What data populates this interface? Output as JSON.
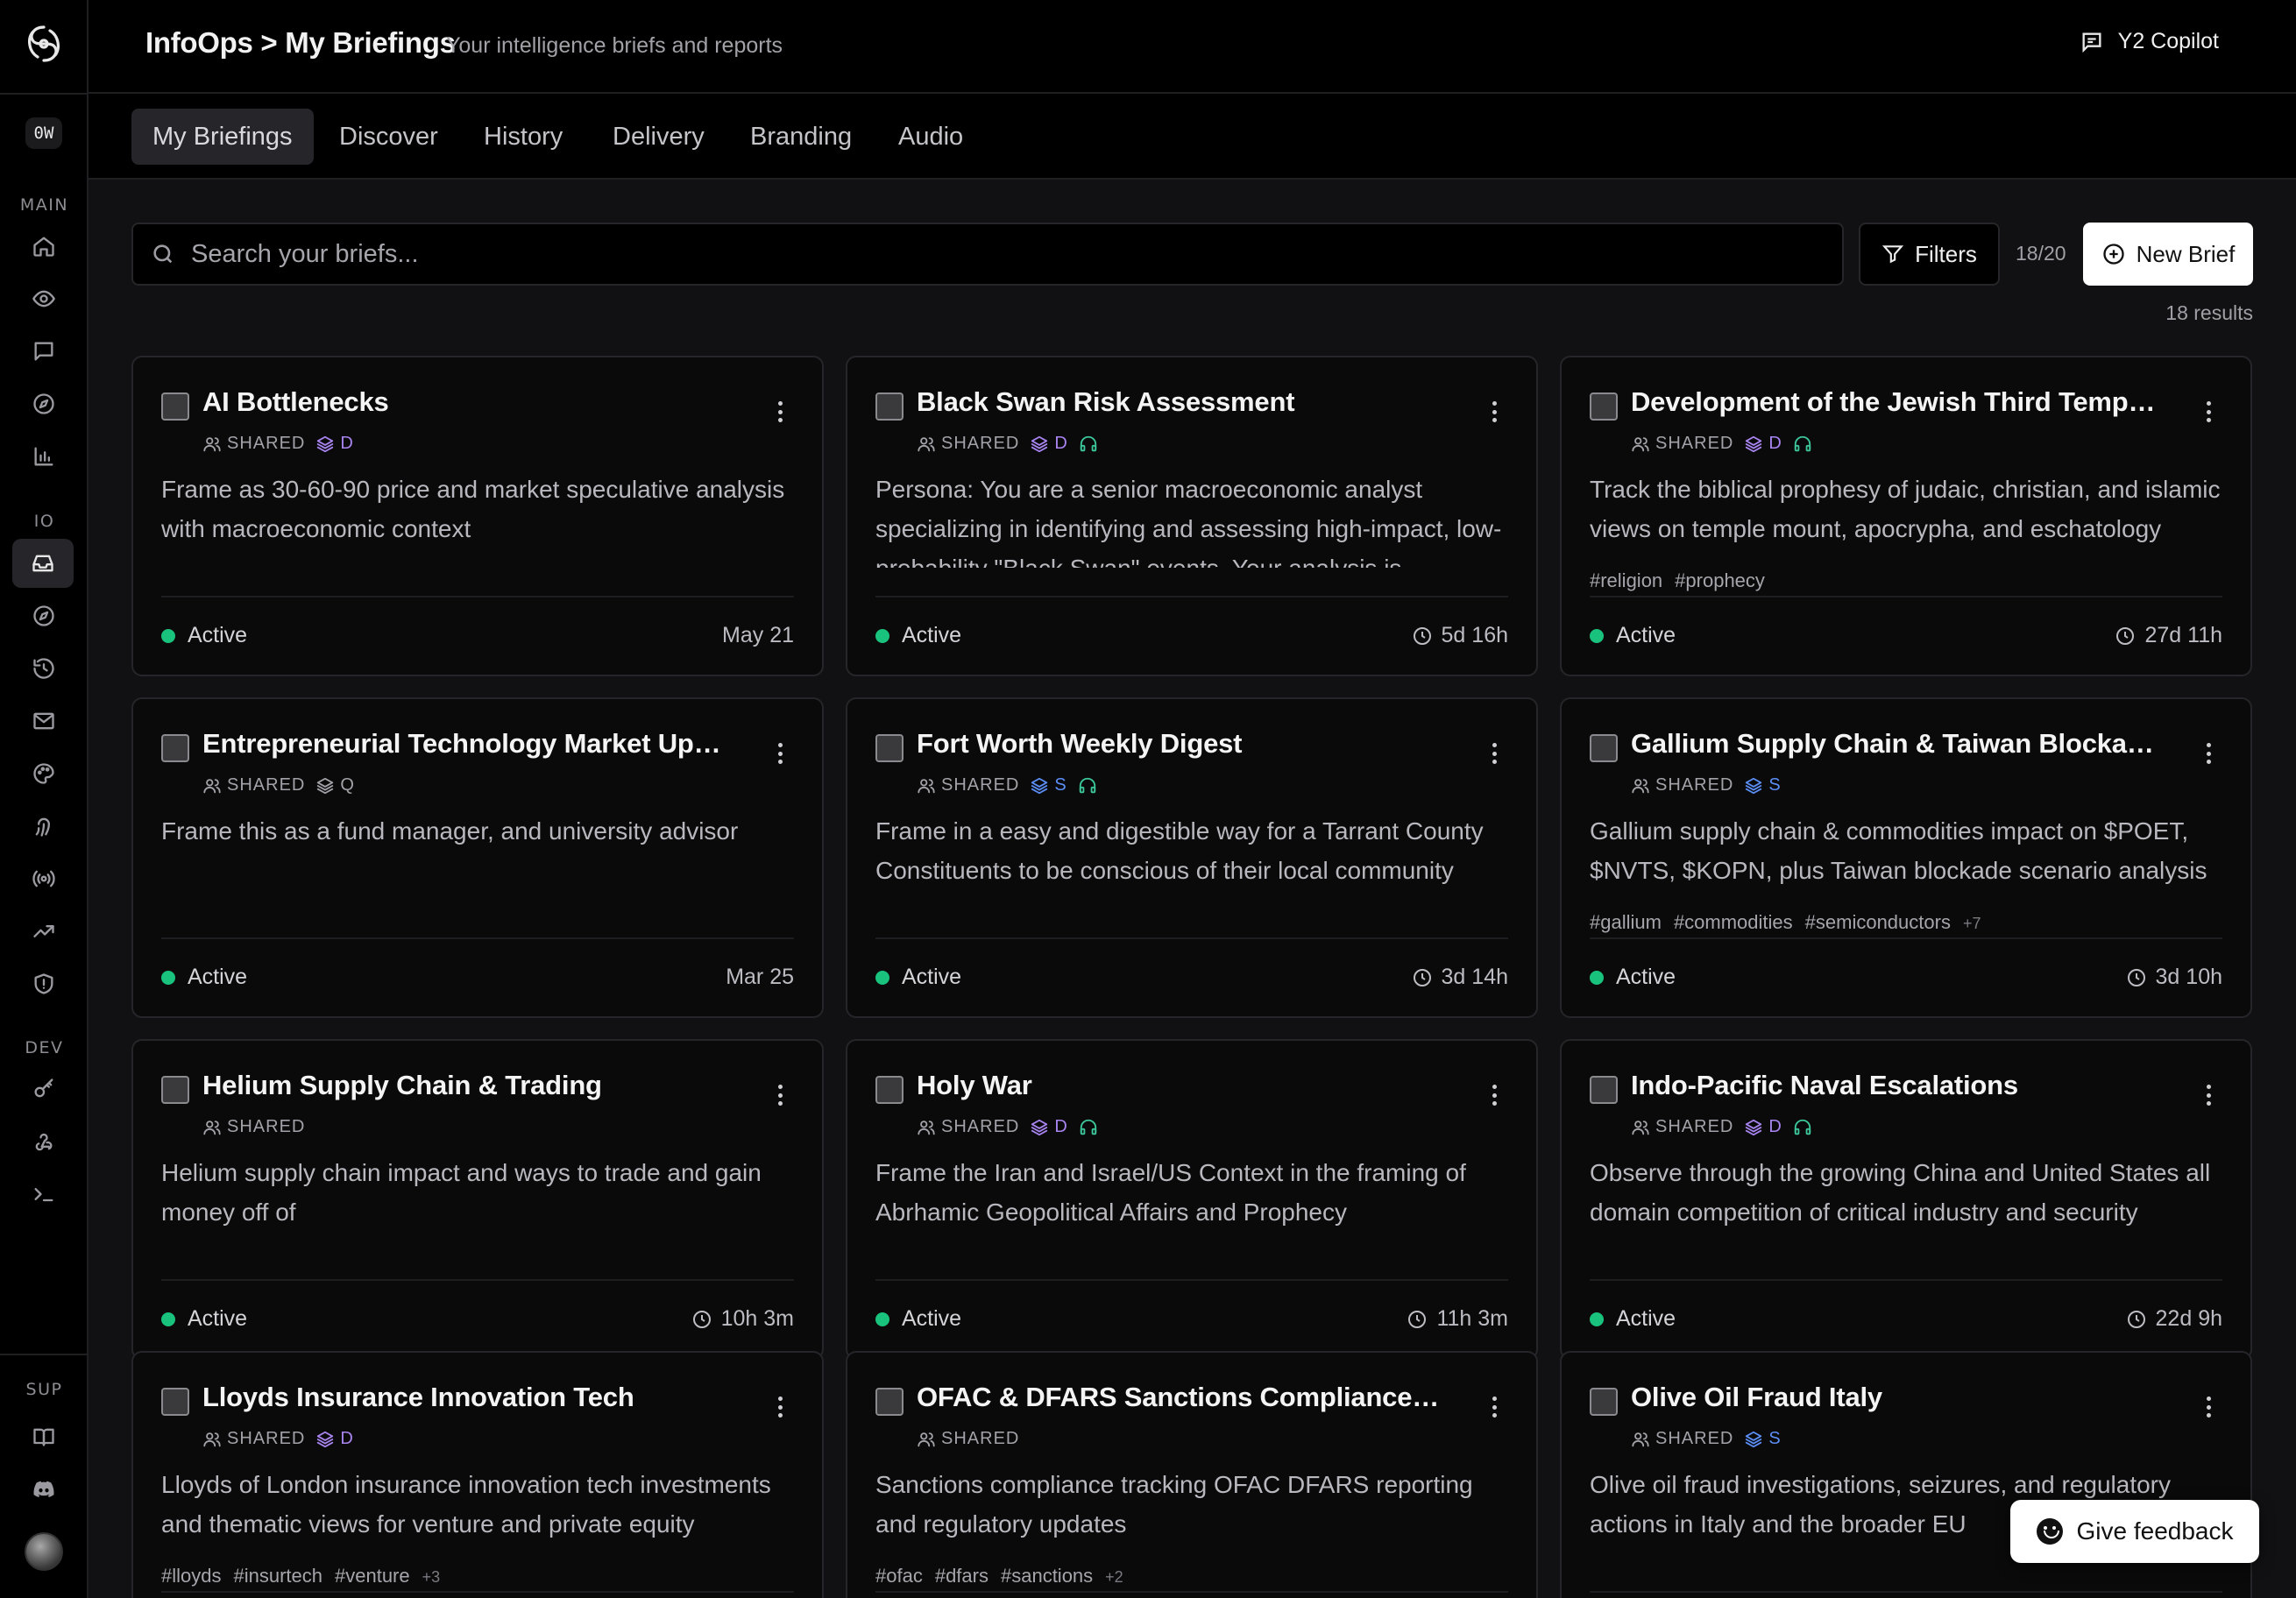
{
  "header": {
    "breadcrumb": "InfoOps > My Briefings",
    "subtitle": "Your intelligence briefs and reports",
    "copilot_label": "Y2 Copilot"
  },
  "sidebar": {
    "workspace_initials": "0W",
    "sections": {
      "main": "MAIN",
      "io": "IO",
      "dev": "DEV",
      "sup": "SUP"
    },
    "icons": [
      "home-icon",
      "eye-icon",
      "chat-icon",
      "compass-icon",
      "bar-chart-icon",
      "inbox-icon",
      "compass-icon",
      "history-icon",
      "mail-icon",
      "palette-icon",
      "fingerprint-icon",
      "broadcast-icon",
      "trending-icon",
      "shield-icon",
      "key-icon",
      "webhook-icon",
      "terminal-icon",
      "book-icon",
      "discord-icon"
    ]
  },
  "tabs": [
    {
      "label": "My Briefings",
      "active": true
    },
    {
      "label": "Discover"
    },
    {
      "label": "History"
    },
    {
      "label": "Delivery"
    },
    {
      "label": "Branding"
    },
    {
      "label": "Audio"
    }
  ],
  "toolbar": {
    "search_placeholder": "Search your briefs...",
    "filters_label": "Filters",
    "quota": "18/20",
    "new_brief_label": "New Brief",
    "results": "18 results"
  },
  "shared_label": "SHARED",
  "briefs": [
    {
      "title": "AI Bottlenecks",
      "tier": "D",
      "audio": false,
      "desc": "Frame as 30-60-90 price and market speculative analysis with macroeconomic context",
      "tags": [],
      "status": "Active",
      "when": "May 21",
      "clock": false
    },
    {
      "title": "Black Swan Risk Assessment",
      "tier": "D",
      "audio": true,
      "desc": "Persona: You are a senior macroeconomic analyst specializing in identifying and assessing high-impact, low-probability \"Black Swan\" events. Your analysis is",
      "tags": [],
      "status": "Active",
      "when": "5d 16h",
      "clock": true
    },
    {
      "title": "Development of the Jewish Third Temple in Jerusalem",
      "tier": "D",
      "audio": true,
      "desc": "Track the biblical prophesy of judaic, christian, and islamic views on temple mount, apocrypha, and eschatology",
      "tags": [
        "#religion",
        "#prophecy"
      ],
      "status": "Active",
      "when": "27d 11h",
      "clock": true
    },
    {
      "title": "Entrepreneurial Technology Market Updates",
      "tier": "Q",
      "audio": false,
      "desc": "Frame this as a fund manager, and university advisor",
      "tags": [],
      "status": "Active",
      "when": "Mar 25",
      "clock": false
    },
    {
      "title": "Fort Worth Weekly Digest",
      "tier": "S",
      "audio": true,
      "desc": "Frame in a easy and digestible way for a Tarrant County Constituents to be conscious of their local community",
      "tags": [],
      "status": "Active",
      "when": "3d 14h",
      "clock": true
    },
    {
      "title": "Gallium Supply Chain & Taiwan Blockade Scenarios",
      "tier": "S",
      "audio": false,
      "desc": "Gallium supply chain & commodities impact on $POET, $NVTS, $KOPN, plus Taiwan blockade scenario analysis",
      "tags": [
        "#gallium",
        "#commodities",
        "#semiconductors"
      ],
      "more": "+7",
      "status": "Active",
      "when": "3d 10h",
      "clock": true
    },
    {
      "title": "Helium Supply Chain & Trading",
      "tier": "",
      "audio": false,
      "desc": "Helium supply chain impact and ways to trade and gain money off of",
      "tags": [],
      "status": "Active",
      "when": "10h 3m",
      "clock": true
    },
    {
      "title": "Holy War",
      "tier": "D",
      "audio": true,
      "desc": "Frame the Iran and Israel/US Context in the framing of Abrhamic Geopolitical Affairs and Prophecy",
      "tags": [],
      "status": "Active",
      "when": "11h 3m",
      "clock": true
    },
    {
      "title": "Indo-Pacific Naval Escalations",
      "tier": "D",
      "audio": true,
      "desc": "Observe through the growing China and United States all domain competition of critical industry and security",
      "tags": [],
      "status": "Active",
      "when": "22d 9h",
      "clock": true
    },
    {
      "title": "Lloyds Insurance Innovation Tech",
      "tier": "D",
      "audio": false,
      "desc": "Lloyds of London insurance innovation tech investments and thematic views for venture and private equity",
      "tags": [
        "#lloyds",
        "#insurtech",
        "#venture"
      ],
      "more": "+3",
      "status": "Active",
      "when": "",
      "clock": false
    },
    {
      "title": "OFAC & DFARS Sanctions Compliance Tracker",
      "tier": "",
      "audio": false,
      "desc": "Sanctions compliance tracking OFAC DFARS reporting and regulatory updates",
      "tags": [
        "#ofac",
        "#dfars",
        "#sanctions"
      ],
      "more": "+2",
      "status": "Active",
      "when": "",
      "clock": false
    },
    {
      "title": "Olive Oil Fraud Italy",
      "tier": "S",
      "audio": false,
      "desc": "Olive oil fraud investigations, seizures, and regulatory actions in Italy and the broader EU",
      "tags": [],
      "status": "Active",
      "when": "",
      "clock": false
    }
  ],
  "feedback_label": "Give feedback",
  "colors": {
    "accent_active": "#19c37d",
    "tier_d": "#a884f0",
    "tier_s": "#5b8ef5",
    "audio": "#3cc79a"
  }
}
